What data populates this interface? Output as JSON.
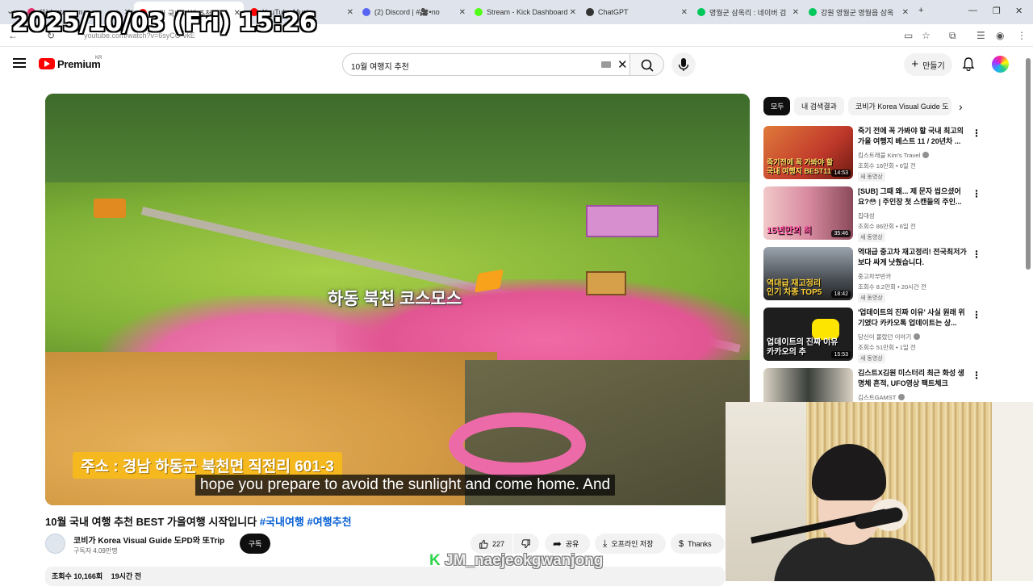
{
  "overlay": {
    "timestamp": "2025/10/03 (Fri) 15:26"
  },
  "browser": {
    "tabs": [
      {
        "label": "(1) Instagram",
        "color": "#e1306c"
      },
      {
        "label": "10월 국내 여행 추천",
        "color": "#ff0000"
      },
      {
        "label": "YouTube Music",
        "color": "#ff0000"
      },
      {
        "label": "(2) Discord | #🎥•no",
        "color": "#5865f2"
      },
      {
        "label": "Stream - Kick Dashboard",
        "color": "#53fc18"
      },
      {
        "label": "ChatGPT",
        "color": "#333333"
      },
      {
        "label": "영월군 삼옥리 : 네이버 검",
        "color": "#03c75a"
      },
      {
        "label": "강원 영월군 영월읍 삼옥",
        "color": "#03c75a"
      }
    ],
    "url": "youtube.com/watch?v=6syCO-vkE"
  },
  "header": {
    "brand": "Premium",
    "country": "KR",
    "search_value": "10월 여행지 추천",
    "create_label": "만들기"
  },
  "video": {
    "place_caption": "하동 북천 코스모스",
    "address_caption": "주소 : 경남 하동군 북천면 직전리 601-3",
    "subtitle": "hope you prepare to avoid the sunlight and come home.  And"
  },
  "info": {
    "title": "10월 국내 여행 추천 BEST 가을여행 시작입니다",
    "hashtags": "#국내여행 #여행추천",
    "channel": "코비가 Korea Visual Guide 도PD와 또Trip",
    "subscribers": "구독자 4.09만명",
    "subscribe_label": "구독",
    "likes": "227",
    "share_label": "공유",
    "download_label": "오프라인 저장",
    "thanks_label": "Thanks",
    "views": "조회수 10,166회",
    "age": "19시간 전"
  },
  "watermark": {
    "logo": "K",
    "name": "JM_naejeokgwanjong"
  },
  "sidebar": {
    "chips": [
      "모두",
      "내 검색결과",
      "코비가 Korea Visual Guide 도"
    ],
    "items": [
      {
        "title": "죽기 전에 꼭 가봐야 할 국내 최고의 가을 여행지 베스트 11 / 20년차 ...",
        "channel": "킴스트래블 Kim's Travel",
        "verified": true,
        "meta": "조회수 16만회 • 6일 전",
        "badge": "새 동영상",
        "duration": "14:53",
        "thumb_text": "죽기전에 꼭 가봐야 할\n국내 여행지 BEST11",
        "thumb_color": "#c0392b"
      },
      {
        "title": "[SUB] 그때 왜... 제 문자 씹으셨어요?😳 | 주인장 첫 스캔들의 주인...",
        "channel": "집대성",
        "verified": false,
        "meta": "조회수 86만회 • 6일 전",
        "badge": "새 동영상",
        "duration": "35:46",
        "thumb_text": "15년만의 최",
        "thumb_color": "#d85a8a"
      },
      {
        "title": "역대급 중고차 재고정리! 전국최저가보다 싸게 낫췄습니다.",
        "channel": "중고차부반카",
        "verified": false,
        "meta": "조회수 8.2만회 • 20시간 전",
        "badge": "새 동영상",
        "duration": "18:42",
        "thumb_text": "역대급 재고정리\n인기 차종 TOP5",
        "thumb_color": "#3a3a3a"
      },
      {
        "title": "'업데이트의 진짜 이유' 사실 원래 위기였다 카카오톡 업데이트는 상...",
        "channel": "당신이 몰랐던 이야기",
        "verified": true,
        "meta": "조회수 51만회 • 1일 전",
        "badge": "새 동영상",
        "duration": "15:53",
        "thumb_text": "업데이트의 진짜 이유\n카카오의 추",
        "thumb_color": "#1e1e1e"
      },
      {
        "title": "김스트X김원 미스터리 최근 화성 생명체 흔적, UFO영상 팩트체크",
        "channel": "김스트GAMST",
        "verified": true,
        "meta": "",
        "badge": "",
        "duration": "",
        "thumb_text": "",
        "thumb_color": "#2b3b2b"
      }
    ]
  }
}
